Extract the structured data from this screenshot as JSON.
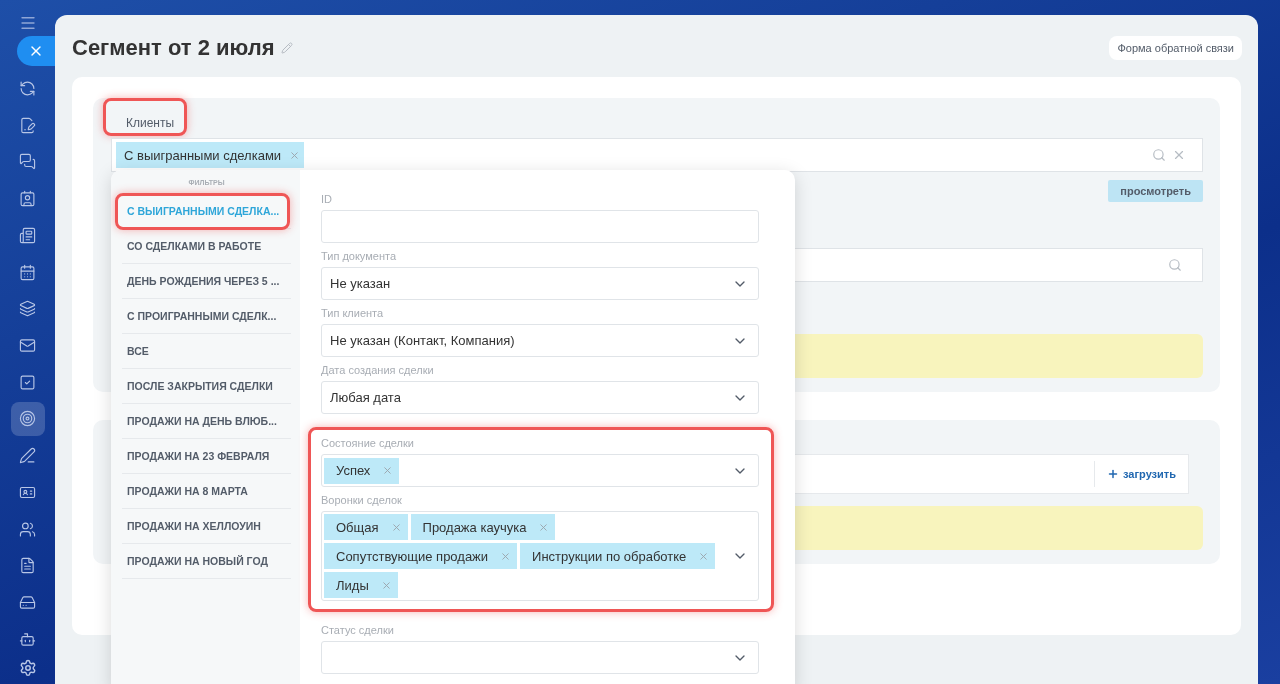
{
  "nav_items": [
    {
      "selected": false
    },
    {
      "selected": false
    },
    {
      "selected": false
    },
    {
      "selected": false
    },
    {
      "selected": false
    },
    {
      "selected": false
    },
    {
      "selected": false
    },
    {
      "selected": false
    },
    {
      "selected": false
    },
    {
      "selected": true
    },
    {
      "selected": false
    },
    {
      "selected": false
    },
    {
      "selected": false
    },
    {
      "selected": false
    },
    {
      "selected": false
    },
    {
      "selected": false
    }
  ],
  "title": "Сегмент от 2 июля",
  "feedback_button": "Форма обратной связи",
  "clients": {
    "label": "Клиенты",
    "highlighted": true,
    "tags": [
      "С выигранными сделками"
    ],
    "view_button": "просмотреть"
  },
  "upload_button": "загрузить",
  "filters_popup": {
    "header": "ФИЛЬТРЫ",
    "items": [
      {
        "label": "С ВЫИГРАННЫМИ СДЕЛКА...",
        "selected": true,
        "highlighted": true
      },
      {
        "label": "СО СДЕЛКАМИ В РАБОТЕ",
        "selected": false,
        "highlighted": false
      },
      {
        "label": "ДЕНЬ РОЖДЕНИЯ ЧЕРЕЗ 5 ...",
        "selected": false,
        "highlighted": false
      },
      {
        "label": "С ПРОИГРАННЫМИ СДЕЛК...",
        "selected": false,
        "highlighted": false
      },
      {
        "label": "ВСЕ",
        "selected": false,
        "highlighted": false
      },
      {
        "label": "ПОСЛЕ ЗАКРЫТИЯ СДЕЛКИ",
        "selected": false,
        "highlighted": false
      },
      {
        "label": "ПРОДАЖИ НА ДЕНЬ ВЛЮБ...",
        "selected": false,
        "highlighted": false
      },
      {
        "label": "ПРОДАЖИ НА 23 ФЕВРАЛЯ",
        "selected": false,
        "highlighted": false
      },
      {
        "label": "ПРОДАЖИ НА 8 МАРТА",
        "selected": false,
        "highlighted": false
      },
      {
        "label": "ПРОДАЖИ НА ХЕЛЛОУИН",
        "selected": false,
        "highlighted": false
      },
      {
        "label": "ПРОДАЖИ НА НОВЫЙ ГОД",
        "selected": false,
        "highlighted": false
      }
    ],
    "groups": [
      {
        "highlighted": false,
        "fields": [
          {
            "kind": "text",
            "label": "ID"
          },
          {
            "kind": "select",
            "label": "Тип документа",
            "value": "Не указан"
          },
          {
            "kind": "select",
            "label": "Тип клиента",
            "value": "Не указан (Контакт, Компания)"
          },
          {
            "kind": "select",
            "label": "Дата создания сделки",
            "value": "Любая дата"
          }
        ]
      },
      {
        "highlighted": true,
        "fields": [
          {
            "kind": "tags",
            "label": "Состояние сделки",
            "tags": [
              "Успех"
            ]
          },
          {
            "kind": "tags",
            "label": "Воронки сделок",
            "tags": [
              "Общая",
              "Продажа каучука",
              "Сопутствующие продажи",
              "Инструкции по обработке",
              "Лиды"
            ]
          }
        ]
      },
      {
        "highlighted": false,
        "fields": [
          {
            "kind": "select",
            "label": "Статус сделки"
          }
        ]
      }
    ]
  }
}
